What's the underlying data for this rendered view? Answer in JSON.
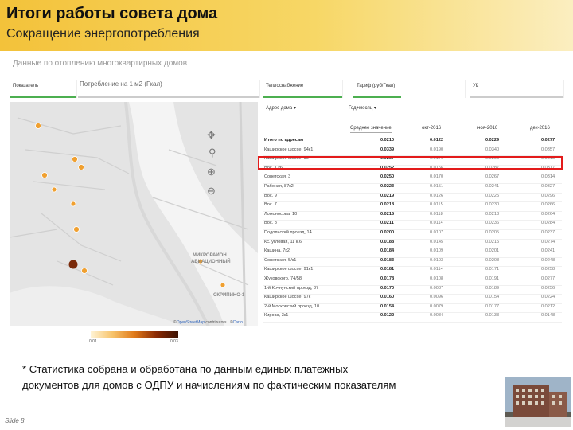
{
  "slide": {
    "title": "Итоги работы совета дома",
    "subtitle": "Сокращение энергопотребления",
    "footnote_line1": "* Статистика собрана и обработана по данным единых платежных",
    "footnote_line2": "документов для домов с ОДПУ и начислениям по фактическим показателям",
    "slide_number": "Slide 8"
  },
  "dashboard": {
    "title": "Данные по отоплению многоквартирных домов",
    "filters": [
      {
        "label": "Показатель"
      },
      {
        "label": "Потребление на 1 м2 (Гкал)"
      },
      {
        "label": "Теплоснабжение"
      },
      {
        "label": "Тариф (руб/Гкал)"
      },
      {
        "label": "УК"
      }
    ],
    "map": {
      "label_district": "МИКРОРАЙОН",
      "label_district2": "АВИАЦИОННЫЙ",
      "label_place": "СКРИПИНО-1",
      "credit_prefix": "©",
      "credit_link": "OpenStreetMap",
      "credit_text": " contributors · ©",
      "credit_link2": "Carto",
      "legend_min": "0.01",
      "legend_max": "0.03",
      "marker_color": "#f0a030",
      "marker_dark": "#7a2a0a"
    },
    "table": {
      "select_address": "Адрес дома",
      "select_period": "Год+месяц",
      "col_measure": "Среднее значение",
      "col_m1": "окт-2016",
      "col_m2": "ноя-2016",
      "col_m3": "дек-2016",
      "rows": [
        {
          "name": "Итого по адресам",
          "avg": "0.0210",
          "m1": "0.0122",
          "m2": "0.0229",
          "m3": "0.0277"
        },
        {
          "name": "Каширское шоссе, 94к1",
          "avg": "0.0339",
          "m1": "0.0190",
          "m2": "0.0340",
          "m3": "0.0357"
        },
        {
          "name": "Каширское шоссе, 90",
          "avg": "0.0257",
          "m1": "0.0176",
          "m2": "0.0298",
          "m3": "0.0318"
        },
        {
          "name": "Вос. 1 к6",
          "avg": "0.0252",
          "m1": "0.0156",
          "m2": "0.0287",
          "m3": "0.0317"
        },
        {
          "name": "Советская, 3",
          "avg": "0.0250",
          "m1": "0.0170",
          "m2": "0.0267",
          "m3": "0.0314"
        },
        {
          "name": "Рабочая, 87к2",
          "avg": "0.0223",
          "m1": "0.0151",
          "m2": "0.0241",
          "m3": "0.0327"
        },
        {
          "name": "Вос. 9",
          "avg": "0.0219",
          "m1": "0.0126",
          "m2": "0.0225",
          "m3": "0.0296"
        },
        {
          "name": "Вос. 7",
          "avg": "0.0218",
          "m1": "0.0115",
          "m2": "0.0230",
          "m3": "0.0266"
        },
        {
          "name": "Ломоносова, 10",
          "avg": "0.0215",
          "m1": "0.0118",
          "m2": "0.0213",
          "m3": "0.0264"
        },
        {
          "name": "Вос. 8",
          "avg": "0.0211",
          "m1": "0.0114",
          "m2": "0.0236",
          "m3": "0.0284"
        },
        {
          "name": "Подольский проезд, 14",
          "avg": "0.0200",
          "m1": "0.0107",
          "m2": "0.0205",
          "m3": "0.0237"
        },
        {
          "name": "Кс. угловая, 11 к.6",
          "avg": "0.0188",
          "m1": "0.0145",
          "m2": "0.0215",
          "m3": "0.0274"
        },
        {
          "name": "Кашина, 7к2",
          "avg": "0.0184",
          "m1": "0.0109",
          "m2": "0.0201",
          "m3": "0.0241"
        },
        {
          "name": "Советская, 5/к1",
          "avg": "0.0183",
          "m1": "0.0103",
          "m2": "0.0208",
          "m3": "0.0248"
        },
        {
          "name": "Каширское шоссе, 91к1",
          "avg": "0.0181",
          "m1": "0.0114",
          "m2": "0.0171",
          "m3": "0.0258"
        },
        {
          "name": "Жуковского, 74/58",
          "avg": "0.0178",
          "m1": "0.0108",
          "m2": "0.0191",
          "m3": "0.0277"
        },
        {
          "name": "1-й Кочнунский проезд, 37",
          "avg": "0.0170",
          "m1": "0.0087",
          "m2": "0.0189",
          "m3": "0.0256"
        },
        {
          "name": "Каширское шоссе, 97к",
          "avg": "0.0160",
          "m1": "0.0096",
          "m2": "0.0154",
          "m3": "0.0224"
        },
        {
          "name": "2-й Московский проезд, 10",
          "avg": "0.0154",
          "m1": "0.0079",
          "m2": "0.0177",
          "m3": "0.0212"
        },
        {
          "name": "Кирова, 3к1",
          "avg": "0.0122",
          "m1": "0.0084",
          "m2": "0.0133",
          "m3": "0.0148"
        }
      ]
    }
  }
}
